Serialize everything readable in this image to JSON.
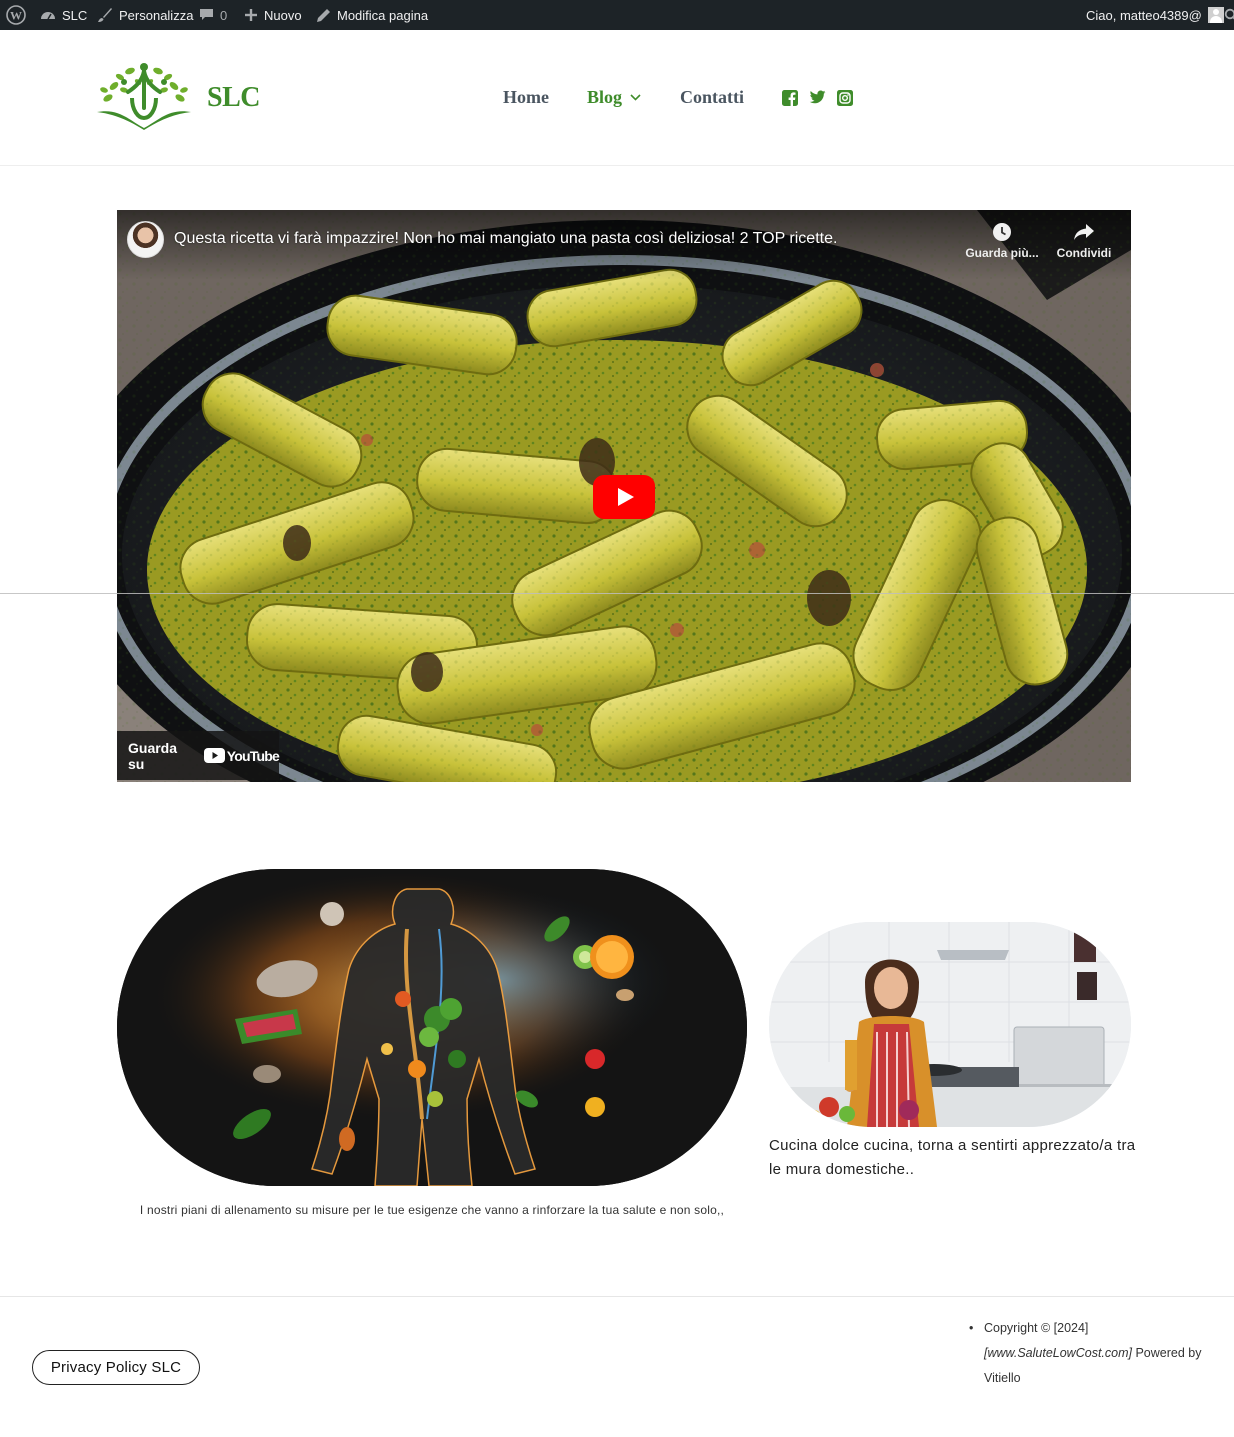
{
  "admin_bar": {
    "site_name": "SLC",
    "customize": "Personalizza",
    "comments_count": "0",
    "new": "Nuovo",
    "edit_page": "Modifica pagina",
    "greeting": "Ciao, matteo4389@"
  },
  "header": {
    "site_title": "SLC",
    "nav": {
      "home": "Home",
      "blog": "Blog",
      "contact": "Contatti"
    },
    "social_icons": [
      "facebook-icon",
      "twitter-icon",
      "instagram-icon"
    ],
    "brand_color": "#3f8c2b"
  },
  "video": {
    "title": "Questa ricetta vi farà impazzire! Non ho mai mangiato una pasta così deliziosa! 2 TOP ricette.",
    "watch_later": "Guarda più...",
    "share": "Condividi",
    "watch_on": "Guarda su",
    "youtube": "YouTube",
    "play_color": "#ff0000"
  },
  "features": {
    "caption_training": "I nostri piani di allenamento su misure per le tue esigenze che vanno a rinforzare la tua salute e non solo,,",
    "caption_cooking": "Cucina dolce cucina, torna a sentirti apprezzato/a tra le mura domestiche.."
  },
  "footer": {
    "privacy_button": "Privacy Policy SLC",
    "copyright_prefix": "Copyright © [2024]",
    "copyright_site": "[www.SaluteLowCost.com]",
    "copyright_powered": "Powered by Vitiello"
  }
}
